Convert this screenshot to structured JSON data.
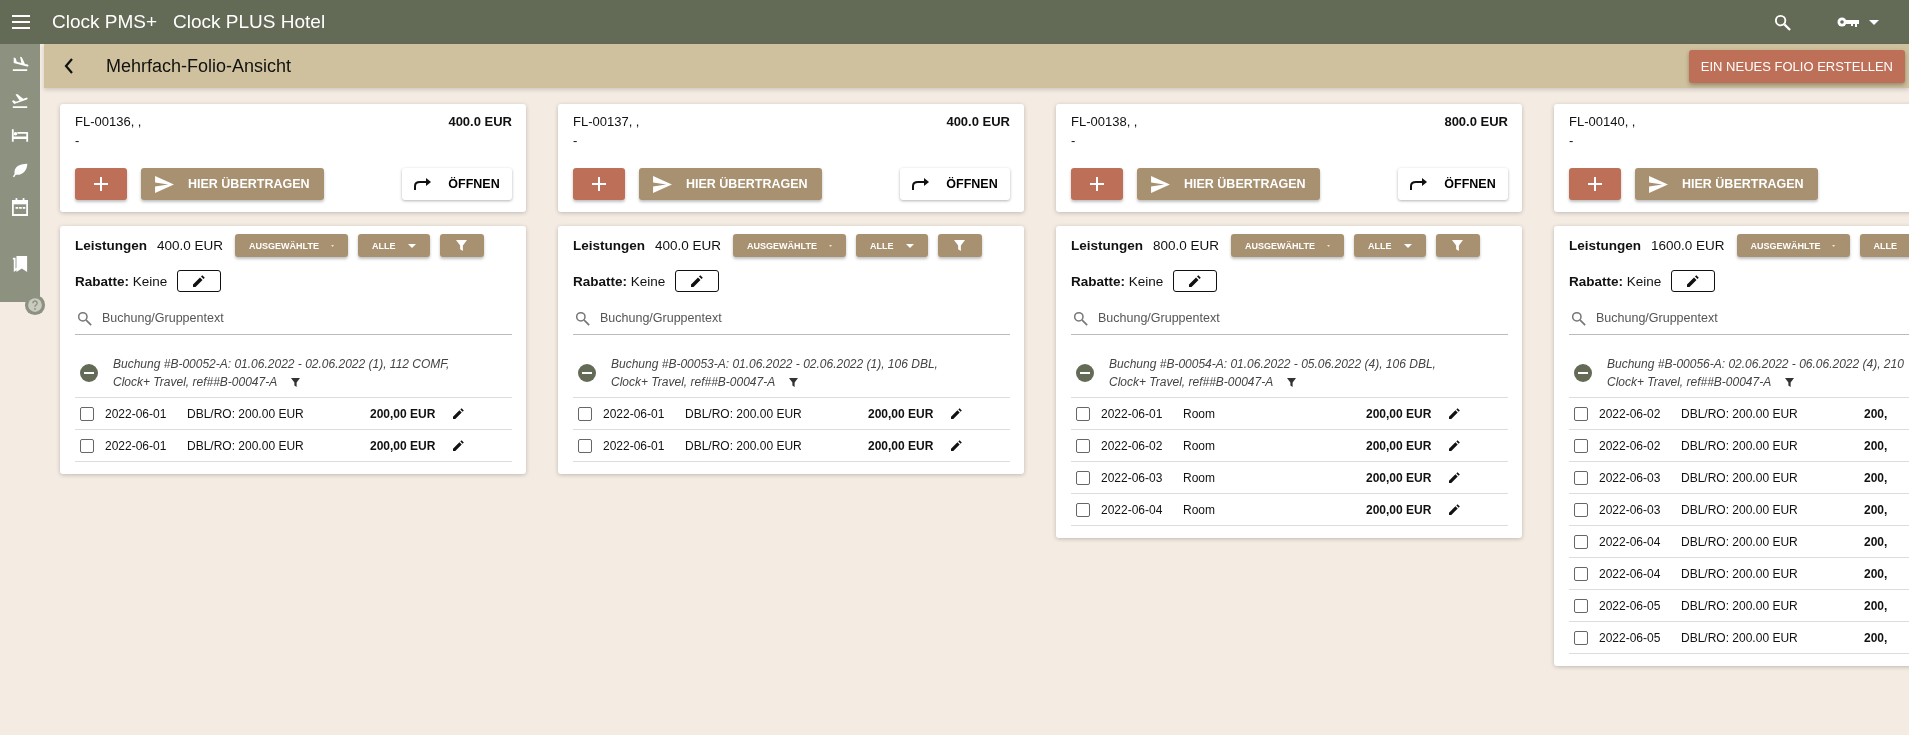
{
  "app": {
    "brand": "Clock PMS+",
    "hotel": "Clock PLUS Hotel"
  },
  "page": {
    "title": "Mehrfach-Folio-Ansicht",
    "create_button": "EIN NEUES FOLIO ERSTELLEN"
  },
  "folios": [
    {
      "number": "FL-00136, ,",
      "subtitle": "-",
      "total": "400.0 EUR",
      "transfer_label": "HIER ÜBERTRAGEN",
      "open_label": "ÖFFNEN",
      "services_label": "Leistungen",
      "services_total": "400.0 EUR",
      "filters": [
        {
          "kind": "dropdown",
          "label": "AUSGEWÄHLTE"
        },
        {
          "kind": "dropdown",
          "label": "ALLE"
        },
        {
          "kind": "filter"
        }
      ],
      "discount_label": "Rabatte:",
      "discount_value": "Keine",
      "search_placeholder": "Buchung/Gruppentext",
      "booking_lines": [
        "Buchung #B-00052-A: 01.06.2022 - 02.06.2022 (1), 112 COMF,",
        "Clock+ Travel, ref##B-00047-A"
      ],
      "items": [
        {
          "date": "2022-06-01",
          "desc": "DBL/RO: 200.00 EUR",
          "amount": "200,00 EUR",
          "checked": false,
          "editable": true
        },
        {
          "date": "2022-06-01",
          "desc": "DBL/RO: 200.00 EUR",
          "amount": "200,00 EUR",
          "checked": false,
          "editable": true
        }
      ]
    },
    {
      "number": "FL-00137, ,",
      "subtitle": "-",
      "total": "400.0 EUR",
      "transfer_label": "HIER ÜBERTRAGEN",
      "open_label": "ÖFFNEN",
      "services_label": "Leistungen",
      "services_total": "400.0 EUR",
      "filters": [
        {
          "kind": "dropdown",
          "label": "AUSGEWÄHLTE"
        },
        {
          "kind": "dropdown",
          "label": "ALLE"
        },
        {
          "kind": "filter"
        }
      ],
      "discount_label": "Rabatte:",
      "discount_value": "Keine",
      "search_placeholder": "Buchung/Gruppentext",
      "booking_lines": [
        "Buchung #B-00053-A: 01.06.2022 - 02.06.2022 (1), 106 DBL,",
        "Clock+ Travel, ref##B-00047-A"
      ],
      "items": [
        {
          "date": "2022-06-01",
          "desc": "DBL/RO: 200.00 EUR",
          "amount": "200,00 EUR",
          "checked": false,
          "editable": true
        },
        {
          "date": "2022-06-01",
          "desc": "DBL/RO: 200.00 EUR",
          "amount": "200,00 EUR",
          "checked": false,
          "editable": true
        }
      ]
    },
    {
      "number": "FL-00138, ,",
      "subtitle": "-",
      "total": "800.0 EUR",
      "transfer_label": "HIER ÜBERTRAGEN",
      "open_label": "ÖFFNEN",
      "services_label": "Leistungen",
      "services_total": "800.0 EUR",
      "filters": [
        {
          "kind": "dropdown",
          "label": "AUSGEWÄHLTE"
        },
        {
          "kind": "dropdown",
          "label": "ALLE"
        },
        {
          "kind": "filter"
        }
      ],
      "discount_label": "Rabatte:",
      "discount_value": "Keine",
      "search_placeholder": "Buchung/Gruppentext",
      "booking_lines": [
        "Buchung #B-00054-A: 01.06.2022 - 05.06.2022 (4), 106 DBL,",
        "Clock+ Travel, ref##B-00047-A"
      ],
      "items": [
        {
          "date": "2022-06-01",
          "desc": "Room",
          "amount": "200,00 EUR",
          "checked": false,
          "editable": true
        },
        {
          "date": "2022-06-02",
          "desc": "Room",
          "amount": "200,00 EUR",
          "checked": false,
          "editable": true
        },
        {
          "date": "2022-06-03",
          "desc": "Room",
          "amount": "200,00 EUR",
          "checked": false,
          "editable": true
        },
        {
          "date": "2022-06-04",
          "desc": "Room",
          "amount": "200,00 EUR",
          "checked": false,
          "editable": true
        }
      ]
    },
    {
      "number": "FL-00140, ,",
      "subtitle": "-",
      "transfer_label": "HIER ÜBERTRAGEN",
      "services_label": "Leistungen",
      "services_total": "1600.0 EUR",
      "filters": [
        {
          "kind": "dropdown",
          "label": "AUSGEWÄHLTE"
        },
        {
          "kind": "dropdown",
          "label": "ALLE"
        }
      ],
      "discount_label": "Rabatte:",
      "discount_value": "Keine",
      "search_placeholder": "Buchung/Gruppentext",
      "booking_lines": [
        "Buchung #B-00056-A: 02.06.2022 - 06.06.2022 (4), 210",
        "Clock+ Travel, ref##B-00047-A"
      ],
      "items": [
        {
          "date": "2022-06-02",
          "desc": "DBL/RO: 200.00 EUR",
          "amount": "200,",
          "checked": false,
          "editable": false
        },
        {
          "date": "2022-06-02",
          "desc": "DBL/RO: 200.00 EUR",
          "amount": "200,",
          "checked": false,
          "editable": false
        },
        {
          "date": "2022-06-03",
          "desc": "DBL/RO: 200.00 EUR",
          "amount": "200,",
          "checked": false,
          "editable": false
        },
        {
          "date": "2022-06-03",
          "desc": "DBL/RO: 200.00 EUR",
          "amount": "200,",
          "checked": false,
          "editable": false
        },
        {
          "date": "2022-06-04",
          "desc": "DBL/RO: 200.00 EUR",
          "amount": "200,",
          "checked": false,
          "editable": false
        },
        {
          "date": "2022-06-04",
          "desc": "DBL/RO: 200.00 EUR",
          "amount": "200,",
          "checked": false,
          "editable": false
        },
        {
          "date": "2022-06-05",
          "desc": "DBL/RO: 200.00 EUR",
          "amount": "200,",
          "checked": false,
          "editable": false
        },
        {
          "date": "2022-06-05",
          "desc": "DBL/RO: 200.00 EUR",
          "amount": "200,",
          "checked": false,
          "editable": false
        }
      ]
    }
  ]
}
